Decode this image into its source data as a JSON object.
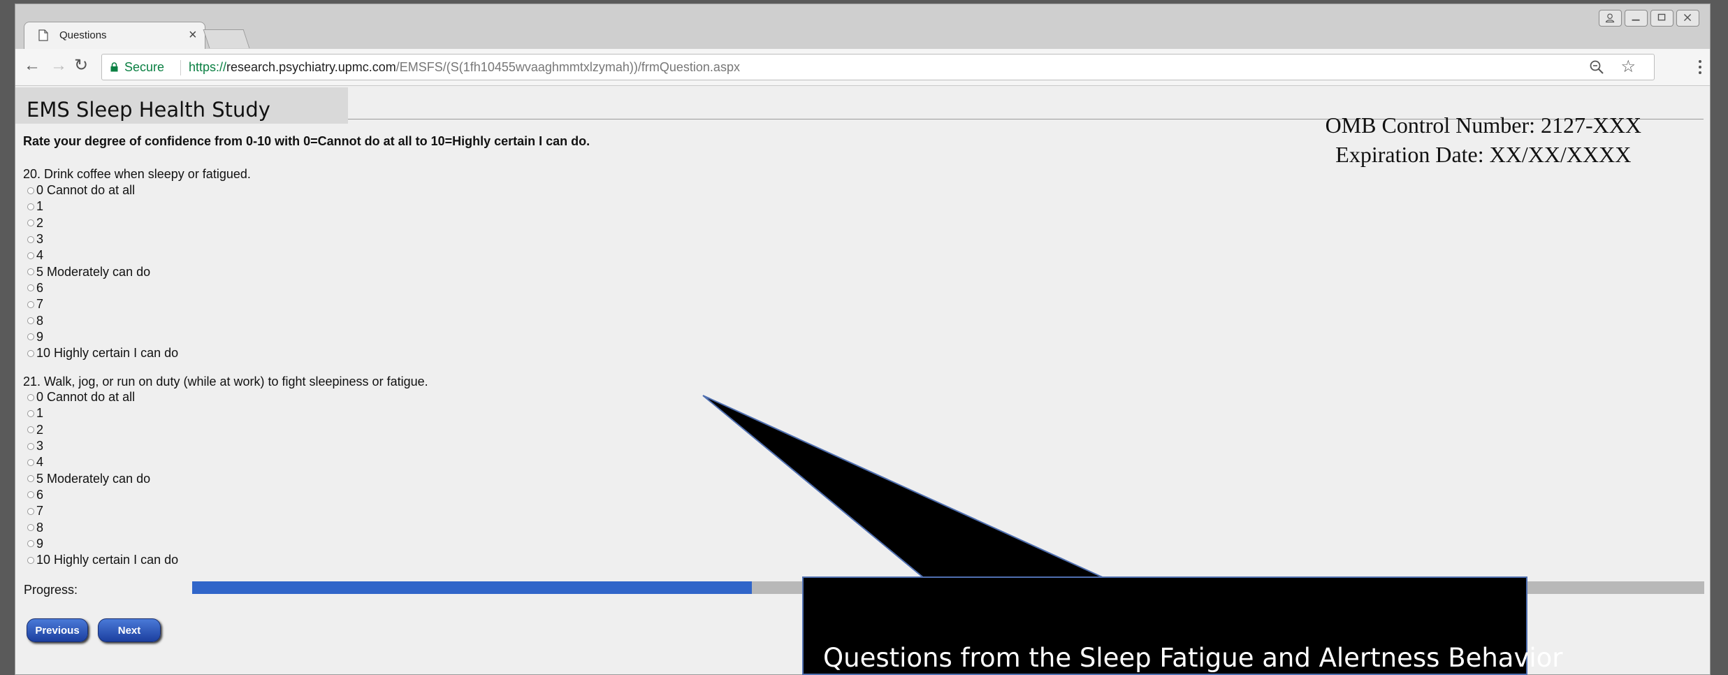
{
  "browser": {
    "tab_title": "Questions",
    "tab_close": "×",
    "secure_label": "Secure",
    "url_protocol": "https://",
    "url_host": "research.psychiatry.upmc.com",
    "url_path": "/EMSFS/(S(1fh10455wvaaghmmtxlzymah))/frmQuestion.aspx"
  },
  "page": {
    "study_title": "EMS Sleep Health Study",
    "omb_line1": "OMB Control Number: 2127-XXX",
    "omb_line2": "Expiration Date:  XX/XX/XXXX",
    "instructions": "Rate your degree of confidence from 0-10 with 0=Cannot do at all to 10=Highly certain I can do."
  },
  "questions": [
    {
      "text": "20. Drink coffee when sleepy or fatigued.",
      "options": [
        "0 Cannot do at all",
        "1",
        "2",
        "3",
        "4",
        "5 Moderately can do",
        "6",
        "7",
        "8",
        "9",
        "10 Highly certain I can do"
      ]
    },
    {
      "text": "21. Walk, jog, or run on duty (while at work) to fight sleepiness or fatigue.",
      "options": [
        "0 Cannot do at all",
        "1",
        "2",
        "3",
        "4",
        "5 Moderately can do",
        "6",
        "7",
        "8",
        "9",
        "10 Highly certain I can do"
      ]
    }
  ],
  "progress": {
    "label": "Progress:",
    "fraction": 0.37
  },
  "buttons": {
    "previous": "Previous",
    "next": "Next"
  },
  "callout": {
    "text": "Questions from the Sleep Fatigue and Alertness Behavior"
  },
  "colors": {
    "progress_fill": "#3065c9",
    "progress_track": "#b8b8b8",
    "secure_green": "#0b8043"
  }
}
